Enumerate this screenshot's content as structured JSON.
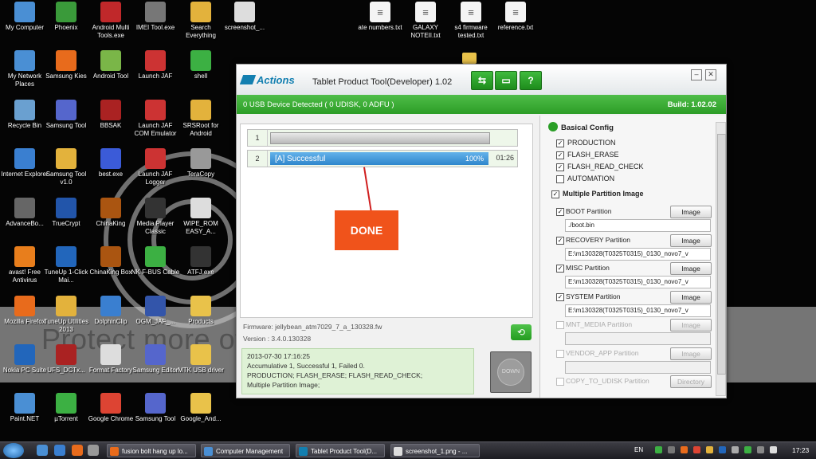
{
  "desktop": {
    "icons": [
      {
        "label": "My Computer",
        "icon": "computer-icon",
        "color": "#4a8fd4"
      },
      {
        "label": "Phoenix",
        "icon": "phoenix-icon",
        "color": "#3a9a3a"
      },
      {
        "label": "Android Multi Tools.exe",
        "icon": "android-multi-tools-icon",
        "color": "#c0282a"
      },
      {
        "label": "IMEI Tool.exe",
        "icon": "imei-tool-icon",
        "color": "#777777"
      },
      {
        "label": "Search Everything",
        "icon": "search-icon",
        "color": "#e3b23c"
      },
      {
        "label": "screenshot_...",
        "icon": "image-file-icon",
        "color": "#dddddd"
      },
      {
        "label": "My Network Places",
        "icon": "network-icon",
        "color": "#4a8fd4"
      },
      {
        "label": "Samsung Kies",
        "icon": "kies-icon",
        "color": "#e86b1c"
      },
      {
        "label": "Android Tool",
        "icon": "android-icon",
        "color": "#7ab648"
      },
      {
        "label": "Launch JAF",
        "icon": "jaf-icon",
        "color": "#cc3333"
      },
      {
        "label": "shell",
        "icon": "play-icon",
        "color": "#3cb043"
      },
      {
        "label": "Recycle Bin",
        "icon": "recycle-bin-icon",
        "color": "#6aa0d0"
      },
      {
        "label": "Samsung Tool",
        "icon": "gear-icon",
        "color": "#5566cc"
      },
      {
        "label": "BBSAK",
        "icon": "bbsak-icon",
        "color": "#aa2222"
      },
      {
        "label": "Launch JAF COM Emulator",
        "icon": "jaf-emulator-icon",
        "color": "#cc3333"
      },
      {
        "label": "SRSRoot for Android",
        "icon": "lock-icon",
        "color": "#e3b23c"
      },
      {
        "label": "Internet Explorer",
        "icon": "ie-icon",
        "color": "#3a7fd0"
      },
      {
        "label": "Samsung Tool v1.0",
        "icon": "padlock-icon",
        "color": "#e3b23c"
      },
      {
        "label": "best.exe",
        "icon": "app-icon",
        "color": "#3b5bd8"
      },
      {
        "label": "Launch JAF Logger",
        "icon": "jaf-logger-icon",
        "color": "#cc3333"
      },
      {
        "label": "TeraCopy",
        "icon": "drive-icon",
        "color": "#999999"
      },
      {
        "label": "AdvanceBo...",
        "icon": "advancebox-icon",
        "color": "#666666"
      },
      {
        "label": "TrueCrypt",
        "icon": "truecrypt-icon",
        "color": "#2255aa"
      },
      {
        "label": "ChinaKing",
        "icon": "chinaking-icon",
        "color": "#aa5511"
      },
      {
        "label": "Media Player Classic",
        "icon": "media-player-icon",
        "color": "#333333"
      },
      {
        "label": "WIPE_ROM EASY_A...",
        "icon": "wipe-rom-icon",
        "color": "#dddddd"
      },
      {
        "label": "avast! Free Antivirus",
        "icon": "avast-icon",
        "color": "#e87e1c"
      },
      {
        "label": "TuneUp 1-Click Mai...",
        "icon": "tuneup-icon",
        "color": "#2266bb"
      },
      {
        "label": "ChinaKing Box",
        "icon": "chinaking-box-icon",
        "color": "#aa5511"
      },
      {
        "label": "NK F-BUS Cable",
        "icon": "cable-icon",
        "color": "#3cb043"
      },
      {
        "label": "ATFJ.exe",
        "icon": "atf-icon",
        "color": "#333333"
      },
      {
        "label": "Mozilla Firefox",
        "icon": "firefox-icon",
        "color": "#e86b1c"
      },
      {
        "label": "TuneUp Utilities 2013",
        "icon": "tuneup-utilities-icon",
        "color": "#e3b23c"
      },
      {
        "label": "DolphinClip",
        "icon": "dolphin-icon",
        "color": "#3a7fd0"
      },
      {
        "label": "OGM_JAF_...",
        "icon": "ogm-jaf-icon",
        "color": "#3355aa"
      },
      {
        "label": "Products",
        "icon": "folder-icon",
        "color": "#e9c24a"
      },
      {
        "label": "Nokia PC Suite",
        "icon": "nokia-icon",
        "color": "#2266bb"
      },
      {
        "label": "UFS_DCTx...",
        "icon": "ufs-icon",
        "color": "#aa2222"
      },
      {
        "label": "Format Factory",
        "icon": "format-factory-icon",
        "color": "#dddddd"
      },
      {
        "label": "Samsung Editor",
        "icon": "samsung-editor-icon",
        "color": "#5566cc"
      },
      {
        "label": "MTK USB driver",
        "icon": "folder-icon",
        "color": "#e9c24a"
      },
      {
        "label": "Paint.NET",
        "icon": "paintnet-icon",
        "color": "#4a8fd4"
      },
      {
        "label": "µTorrent",
        "icon": "utorrent-icon",
        "color": "#3cb043"
      },
      {
        "label": "Google Chrome",
        "icon": "chrome-icon",
        "color": "#dd4433"
      },
      {
        "label": "Samsung Tool",
        "icon": "gear-icon",
        "color": "#5566cc"
      },
      {
        "label": "Google_And...",
        "icon": "folder-icon",
        "color": "#e9c24a"
      }
    ],
    "top_files": [
      {
        "label": "ate numbers.txt",
        "icon": "text-file-icon"
      },
      {
        "label": "GALAXY NOTEII.txt",
        "icon": "text-file-icon"
      },
      {
        "label": "s4 firmware tested.txt",
        "icon": "text-file-icon"
      },
      {
        "label": "reference.txt",
        "icon": "text-file-icon"
      }
    ],
    "banner_text": "Protect more of your memories for less!"
  },
  "app": {
    "logo_text": "Actions",
    "title": "Tablet Product Tool(Developer) 1.02",
    "toolbar": {
      "usb_label": "⇆",
      "doc_label": "▭",
      "help_label": "?"
    },
    "status": "0 USB Device Detected ( 0 UDISK, 0 ADFU )",
    "build": "Build: 1.02.02",
    "rows": [
      {
        "num": "1",
        "label": "",
        "percent": "",
        "time": ""
      },
      {
        "num": "2",
        "label": "[A] Successful",
        "percent": "100%",
        "time": "01:26",
        "progress": 1.0
      }
    ],
    "done_label": "DONE",
    "firmware": "Firmware: jellybean_atm7029_7_a_130328.fw",
    "version": "Version : 3.4.0.130328",
    "log": [
      "2013-07-30 17:16:25",
      "Accumulative 1, Successful 1, Failed 0.",
      "PRODUCTION; FLASH_ERASE; FLASH_READ_CHECK;",
      "Multiple Partition Image;"
    ],
    "down_label": "DOWN",
    "config": {
      "title": "Basical Config",
      "options": [
        {
          "label": "PRODUCTION",
          "checked": true
        },
        {
          "label": "FLASH_ERASE",
          "checked": true
        },
        {
          "label": "FLASH_READ_CHECK",
          "checked": true
        },
        {
          "label": "AUTOMATION",
          "checked": false
        }
      ],
      "multi_label": "Multiple Partition Image",
      "partitions": [
        {
          "label": "BOOT Partition",
          "path": "./boot.bin",
          "button": "Image",
          "checked": true,
          "enabled": true
        },
        {
          "label": "RECOVERY Partition",
          "path": "E:\\m130328(T0325T0315)_0130_novo7_v",
          "button": "Image",
          "checked": true,
          "enabled": true
        },
        {
          "label": "MISC Partition",
          "path": "E:\\m130328(T0325T0315)_0130_novo7_v",
          "button": "Image",
          "checked": true,
          "enabled": true
        },
        {
          "label": "SYSTEM Partition",
          "path": "E:\\m130328(T0325T0315)_0130_novo7_v",
          "button": "Image",
          "checked": true,
          "enabled": true
        },
        {
          "label": "MNT_MEDIA Partition",
          "path": "",
          "button": "Image",
          "checked": false,
          "enabled": false
        },
        {
          "label": "VENDOR_APP Partition",
          "path": "",
          "button": "Image",
          "checked": false,
          "enabled": false
        },
        {
          "label": "COPY_TO_UDISK Partition",
          "path": "",
          "button": "Directory",
          "checked": false,
          "enabled": false
        }
      ]
    }
  },
  "taskbar": {
    "buttons": [
      {
        "label": "fusion bolt hang up lo...",
        "icon": "firefox-icon",
        "color": "#e86b1c"
      },
      {
        "label": "Computer Management",
        "icon": "computer-management-icon",
        "color": "#4a8fd4"
      },
      {
        "label": "Tablet Product Tool(D...",
        "icon": "actions-tool-icon",
        "color": "#137fb0"
      },
      {
        "label": "screenshot_1.png - ...",
        "icon": "image-viewer-icon",
        "color": "#dddddd"
      }
    ],
    "lang": "EN",
    "clock": "17:23"
  },
  "colors": {
    "accent": "#2c9d27",
    "done": "#f0531b",
    "progress": "#2f86cc",
    "brand": "#137fb0"
  }
}
